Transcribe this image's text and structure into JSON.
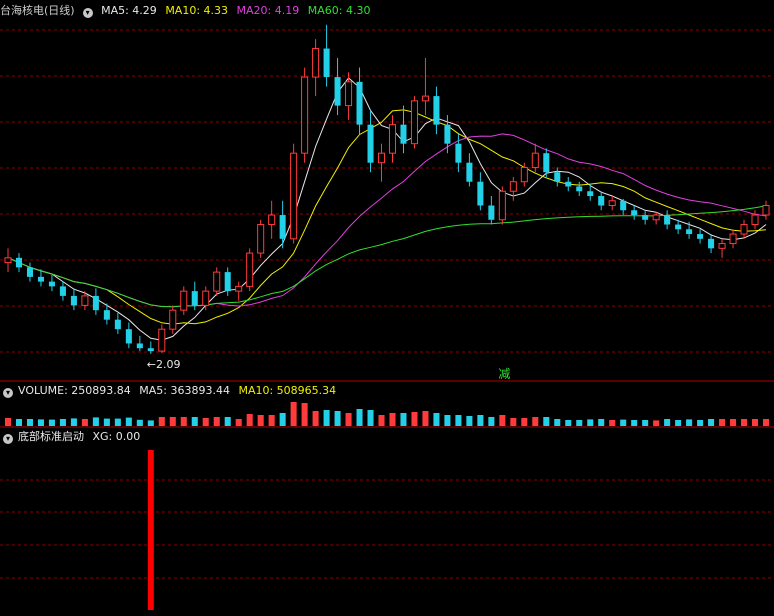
{
  "main": {
    "title": "台海核电(日线)",
    "ma5_label": "MA5: 4.29",
    "ma10_label": "MA10: 4.33",
    "ma20_label": "MA20: 4.19",
    "ma60_label": "MA60: 4.30",
    "low_annotation": "←2.09",
    "signal_label": "减"
  },
  "volume_panel": {
    "title_label": "VOLUME: 250893.84",
    "ma5_label": "MA5: 363893.44",
    "ma10_label": "MA10: 508965.34"
  },
  "indicator_panel": {
    "title": "底部标准启动",
    "xg_label": "XG: 0.00"
  },
  "colors": {
    "background": "#000000",
    "grid": "#8b0000",
    "up": "#ff3b3b",
    "down": "#22d0e8",
    "ma5": "#e8e8e8",
    "ma10": "#f0f000",
    "ma20": "#e040e0",
    "ma60": "#30e030",
    "signal_bar": "#ff0000"
  },
  "icons": {
    "panel_menu": "chevron-down-icon"
  },
  "chart_data": {
    "type": "candlestick",
    "series_labels": [
      "MA5",
      "MA10",
      "MA20",
      "MA60"
    ],
    "latest_values": {
      "MA5": 4.29,
      "MA10": 4.33,
      "MA20": 4.19,
      "MA60": 4.3
    },
    "annotated_low": 2.09,
    "volume": {
      "VOLUME": 250893.84,
      "MA5": 363893.44,
      "MA10": 508965.34
    },
    "indicator": {
      "name": "底部标准启动",
      "XG": 0.0
    },
    "price_range": [
      1.9,
      5.6
    ],
    "candles": [
      [
        3.05,
        3.2,
        2.95,
        3.1
      ],
      [
        3.1,
        3.15,
        2.95,
        3.0
      ],
      [
        3.0,
        3.05,
        2.85,
        2.9
      ],
      [
        2.9,
        2.98,
        2.8,
        2.85
      ],
      [
        2.85,
        2.92,
        2.75,
        2.8
      ],
      [
        2.8,
        2.85,
        2.65,
        2.7
      ],
      [
        2.7,
        2.78,
        2.55,
        2.6
      ],
      [
        2.6,
        2.75,
        2.55,
        2.7
      ],
      [
        2.7,
        2.78,
        2.5,
        2.55
      ],
      [
        2.55,
        2.62,
        2.4,
        2.45
      ],
      [
        2.45,
        2.52,
        2.3,
        2.35
      ],
      [
        2.35,
        2.42,
        2.15,
        2.2
      ],
      [
        2.2,
        2.28,
        2.12,
        2.15
      ],
      [
        2.15,
        2.22,
        2.09,
        2.12
      ],
      [
        2.12,
        2.4,
        2.1,
        2.35
      ],
      [
        2.35,
        2.6,
        2.3,
        2.55
      ],
      [
        2.55,
        2.8,
        2.5,
        2.75
      ],
      [
        2.75,
        2.85,
        2.55,
        2.6
      ],
      [
        2.6,
        2.8,
        2.55,
        2.75
      ],
      [
        2.75,
        3.0,
        2.7,
        2.95
      ],
      [
        2.95,
        3.0,
        2.7,
        2.75
      ],
      [
        2.75,
        2.85,
        2.65,
        2.8
      ],
      [
        2.8,
        3.2,
        2.75,
        3.15
      ],
      [
        3.15,
        3.5,
        3.1,
        3.45
      ],
      [
        3.45,
        3.7,
        3.3,
        3.55
      ],
      [
        3.55,
        3.7,
        3.2,
        3.3
      ],
      [
        3.3,
        4.3,
        3.25,
        4.2
      ],
      [
        4.2,
        5.1,
        4.1,
        5.0
      ],
      [
        5.0,
        5.4,
        4.8,
        5.3
      ],
      [
        5.3,
        5.55,
        4.9,
        5.0
      ],
      [
        5.0,
        5.2,
        4.6,
        4.7
      ],
      [
        4.7,
        5.05,
        4.55,
        4.95
      ],
      [
        4.95,
        5.1,
        4.4,
        4.5
      ],
      [
        4.5,
        4.65,
        4.0,
        4.1
      ],
      [
        4.1,
        4.3,
        3.9,
        4.2
      ],
      [
        4.2,
        4.6,
        4.1,
        4.5
      ],
      [
        4.5,
        4.7,
        4.2,
        4.3
      ],
      [
        4.3,
        4.8,
        4.25,
        4.75
      ],
      [
        4.75,
        5.2,
        4.6,
        4.8
      ],
      [
        4.8,
        4.9,
        4.4,
        4.5
      ],
      [
        4.5,
        4.6,
        4.2,
        4.3
      ],
      [
        4.3,
        4.4,
        4.0,
        4.1
      ],
      [
        4.1,
        4.2,
        3.85,
        3.9
      ],
      [
        3.9,
        4.0,
        3.6,
        3.65
      ],
      [
        3.65,
        3.75,
        3.45,
        3.5
      ],
      [
        3.5,
        3.85,
        3.45,
        3.8
      ],
      [
        3.8,
        3.95,
        3.7,
        3.9
      ],
      [
        3.9,
        4.1,
        3.85,
        4.05
      ],
      [
        4.05,
        4.3,
        4.0,
        4.2
      ],
      [
        4.2,
        4.25,
        3.95,
        4.0
      ],
      [
        4.0,
        4.05,
        3.85,
        3.9
      ],
      [
        3.9,
        3.95,
        3.8,
        3.85
      ],
      [
        3.85,
        3.9,
        3.75,
        3.8
      ],
      [
        3.8,
        3.88,
        3.7,
        3.75
      ],
      [
        3.75,
        3.8,
        3.6,
        3.65
      ],
      [
        3.65,
        3.75,
        3.6,
        3.7
      ],
      [
        3.7,
        3.72,
        3.55,
        3.6
      ],
      [
        3.6,
        3.65,
        3.5,
        3.55
      ],
      [
        3.55,
        3.6,
        3.45,
        3.5
      ],
      [
        3.5,
        3.58,
        3.45,
        3.55
      ],
      [
        3.55,
        3.6,
        3.4,
        3.45
      ],
      [
        3.45,
        3.5,
        3.35,
        3.4
      ],
      [
        3.4,
        3.48,
        3.3,
        3.35
      ],
      [
        3.35,
        3.4,
        3.25,
        3.3
      ],
      [
        3.3,
        3.35,
        3.15,
        3.2
      ],
      [
        3.2,
        3.3,
        3.1,
        3.25
      ],
      [
        3.25,
        3.4,
        3.2,
        3.35
      ],
      [
        3.35,
        3.5,
        3.3,
        3.45
      ],
      [
        3.45,
        3.6,
        3.4,
        3.55
      ],
      [
        3.55,
        3.7,
        3.5,
        3.65
      ]
    ]
  }
}
